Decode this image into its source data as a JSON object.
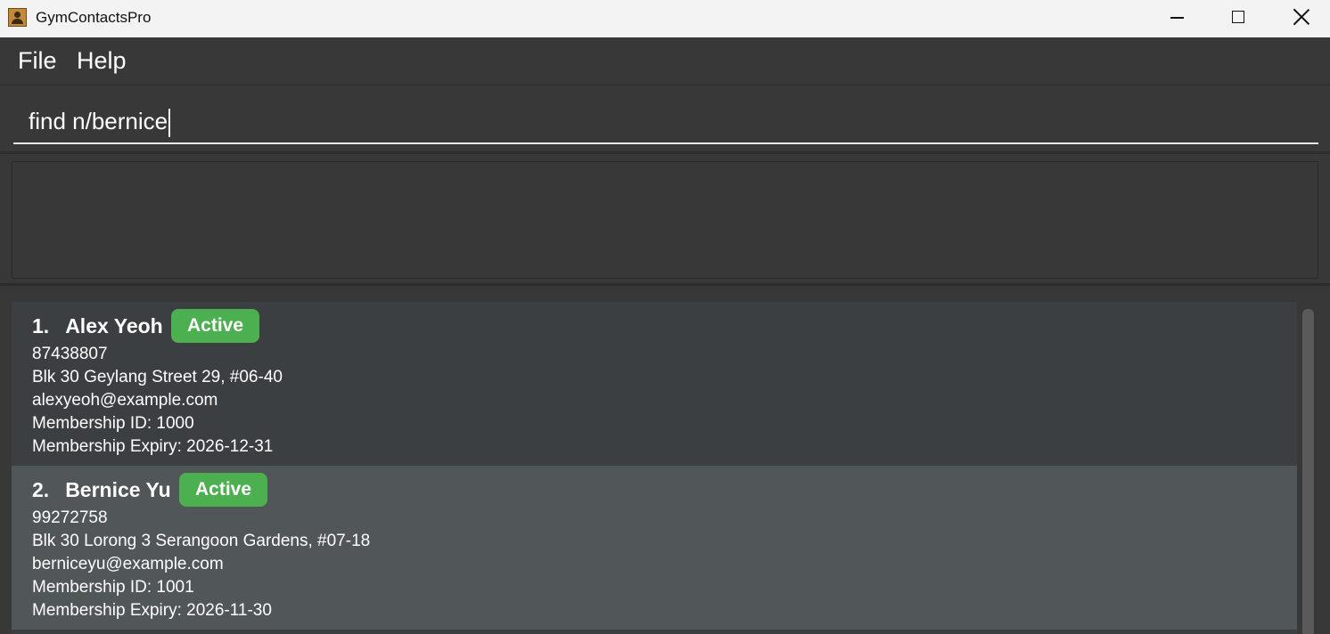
{
  "window": {
    "title": "GymContactsPro",
    "icon": "contacts-app-icon",
    "controls": [
      "minimize-icon",
      "maximize-icon",
      "close-icon"
    ]
  },
  "menu": {
    "file": "File",
    "help": "Help"
  },
  "command_box": {
    "value": "find n/bernice"
  },
  "result_display": {
    "text": ""
  },
  "persons": [
    {
      "index": "1.",
      "name": "Alex Yeoh",
      "status": "Active",
      "phone": "87438807",
      "address": "Blk 30 Geylang Street 29, #06-40",
      "email": "alexyeoh@example.com",
      "membership_id": "Membership ID: 1000",
      "membership_expiry": "Membership Expiry: 2026-12-31"
    },
    {
      "index": "2.",
      "name": "Bernice Yu",
      "status": "Active",
      "phone": "99272758",
      "address": "Blk 30 Lorong 3 Serangoon Gardens, #07-18",
      "email": "berniceyu@example.com",
      "membership_id": "Membership ID: 1001",
      "membership_expiry": "Membership Expiry: 2026-11-30"
    }
  ],
  "colors": {
    "background": "#383838",
    "card": "#3c3f41",
    "card_selected": "#515658",
    "badge_active": "#4caf50",
    "titlebar": "#f3f3f3"
  }
}
